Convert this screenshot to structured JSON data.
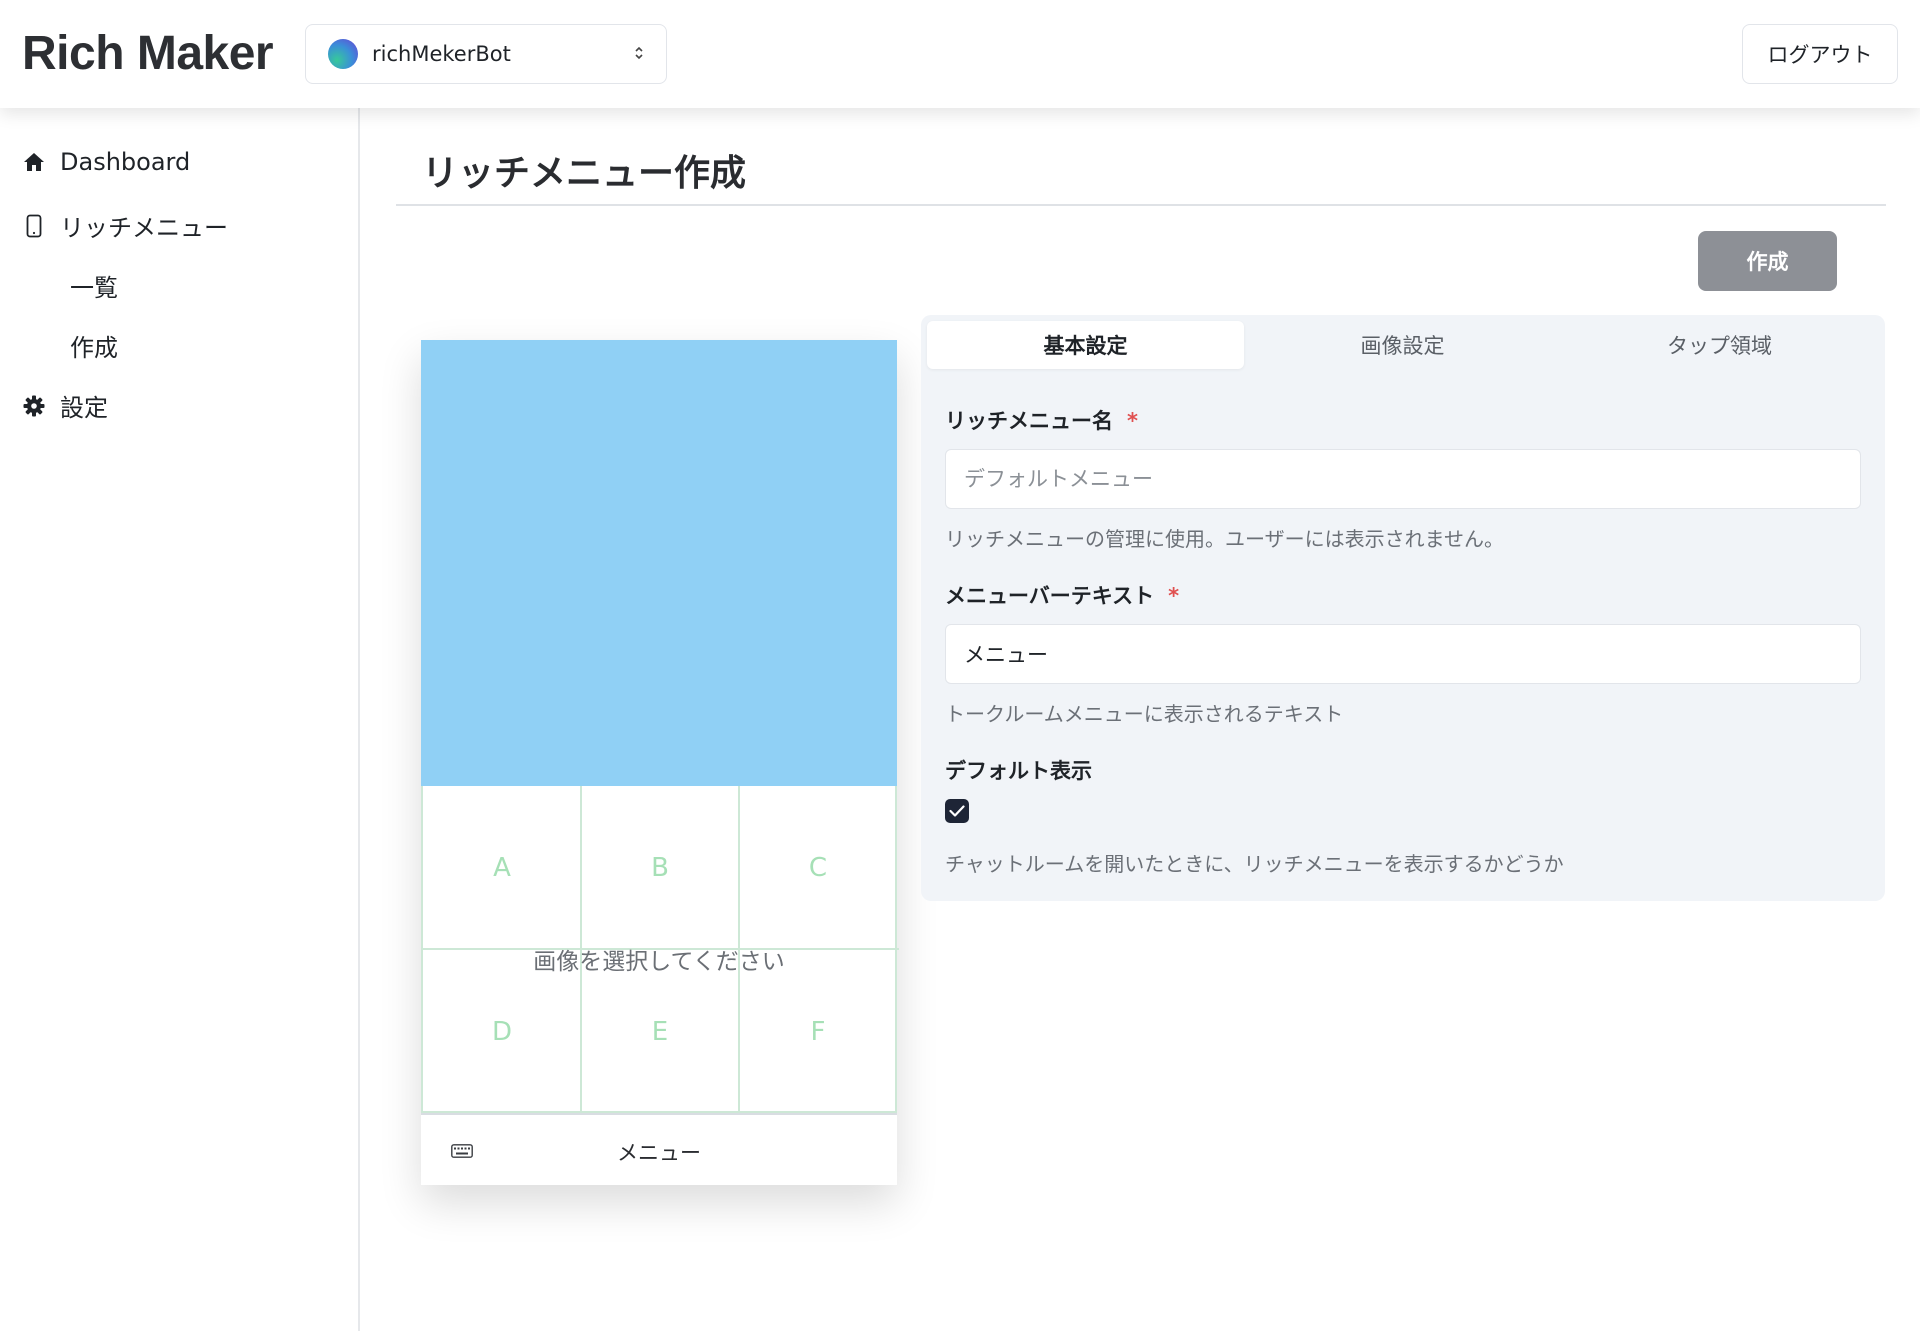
{
  "app": {
    "logo": "Rich Maker",
    "bot_selector": {
      "name": "richMekerBot"
    },
    "logout_label": "ログアウト"
  },
  "sidebar": {
    "items": [
      {
        "label": "Dashboard",
        "icon": "home-icon"
      },
      {
        "label": "リッチメニュー",
        "icon": "phone-icon"
      },
      {
        "label": "一覧"
      },
      {
        "label": "作成"
      },
      {
        "label": "設定",
        "icon": "gear-icon"
      }
    ]
  },
  "main": {
    "title": "リッチメニュー作成",
    "create_button": "作成"
  },
  "preview": {
    "cells": [
      "A",
      "B",
      "C",
      "D",
      "E",
      "F"
    ],
    "placeholder_text": "画像を選択してください",
    "menubar_text": "メニュー",
    "image_color": "#90d0f5"
  },
  "settings": {
    "tabs": [
      "基本設定",
      "画像設定",
      "タップ領域"
    ],
    "active_tab": "基本設定",
    "name_field": {
      "label": "リッチメニュー名",
      "required_mark": "*",
      "placeholder": "デフォルトメニュー",
      "value": "",
      "help": "リッチメニューの管理に使用。ユーザーには表示されません。"
    },
    "menubar_field": {
      "label": "メニューバーテキスト",
      "required_mark": "*",
      "value": "メニュー",
      "help": "トークルームメニューに表示されるテキスト"
    },
    "default_display": {
      "label": "デフォルト表示",
      "checked": true,
      "help": "チャットルームを開いたときに、リッチメニューを表示するかどうか"
    }
  }
}
